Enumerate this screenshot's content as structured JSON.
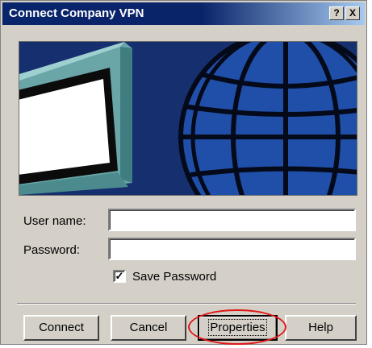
{
  "window": {
    "title": "Connect Company VPN"
  },
  "titlebar_buttons": {
    "help_label": "?",
    "close_label": "X"
  },
  "form": {
    "username_label": "User name:",
    "username_value": "",
    "password_label": "Password:",
    "password_value": "",
    "save_password_label": "Save Password",
    "save_password_checked": true
  },
  "buttons": {
    "connect": "Connect",
    "cancel": "Cancel",
    "properties": "Properties",
    "help": "Help"
  },
  "icons": {
    "banner_monitor": "monitor-icon",
    "banner_globe": "globe-icon",
    "check_mark": "checkmark-icon"
  },
  "colors": {
    "titlebar_start": "#0a246a",
    "titlebar_end": "#a6caf0",
    "dialog_face": "#d4d0c8",
    "banner_blue": "#16306f",
    "globe_blue": "#1f4fa8",
    "monitor_teal": "#5e9b9f",
    "highlight_circle": "#e01818"
  }
}
